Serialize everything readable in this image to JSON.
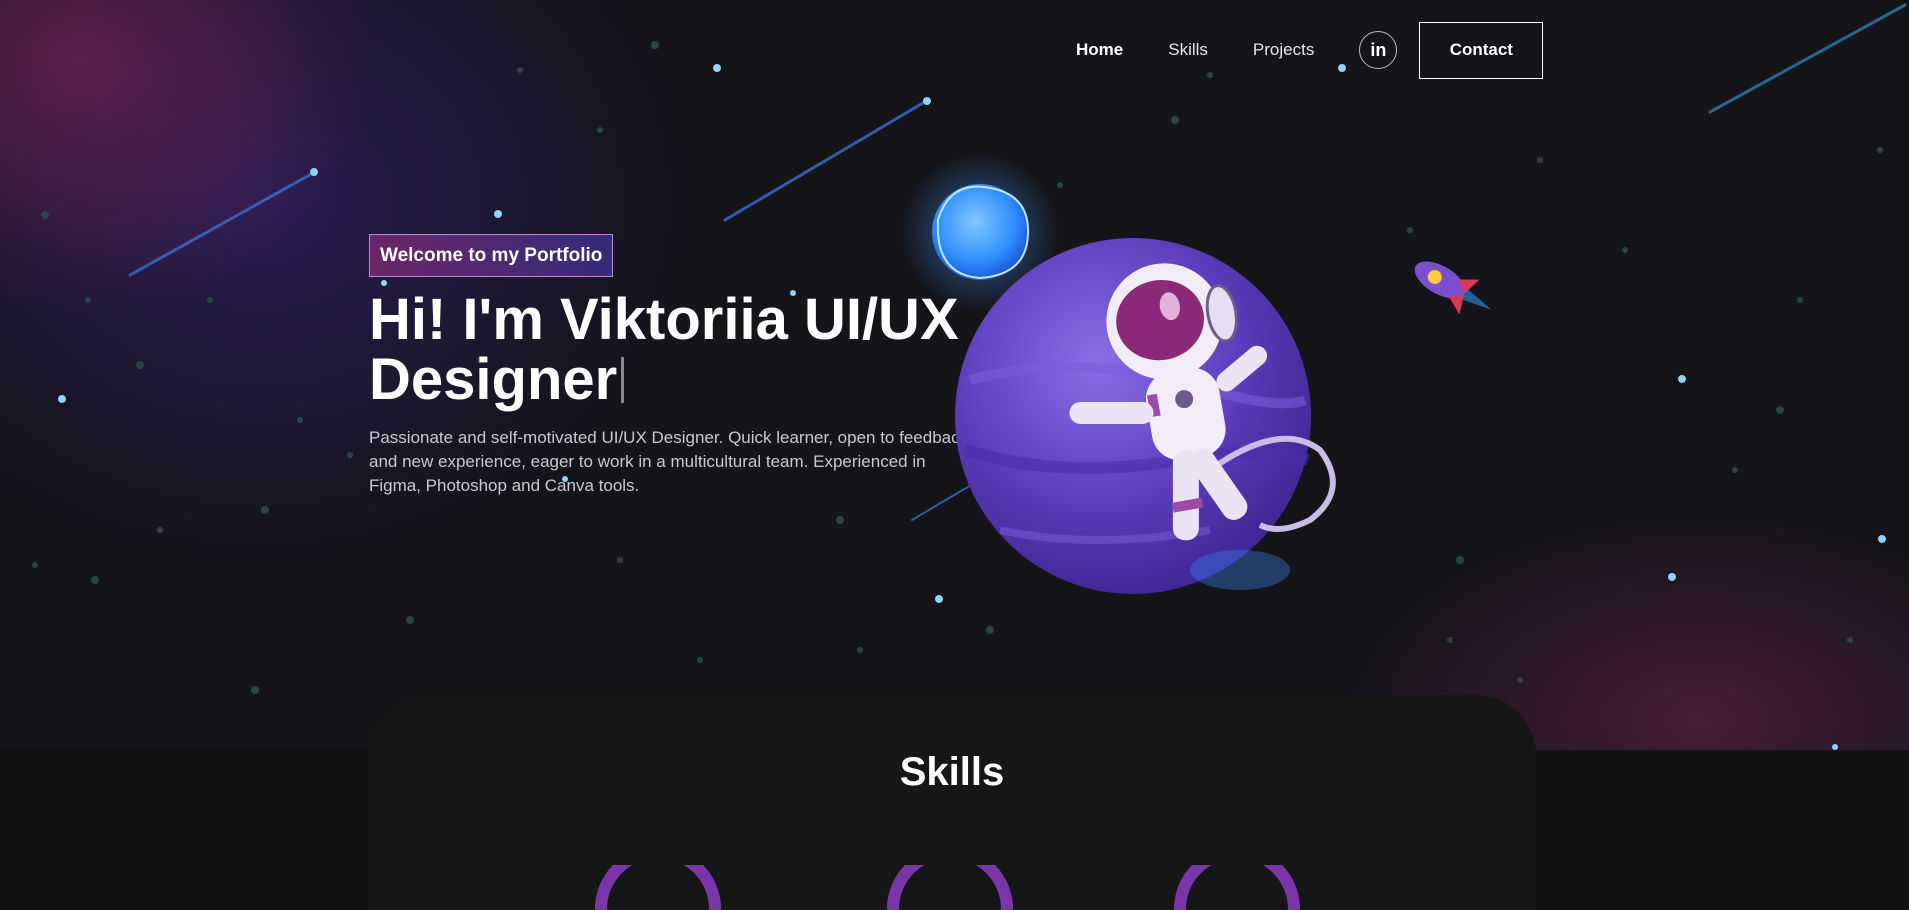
{
  "nav": {
    "items": [
      {
        "label": "Home",
        "active": true
      },
      {
        "label": "Skills",
        "active": false
      },
      {
        "label": "Projects",
        "active": false
      }
    ],
    "linkedin_label": "in",
    "contact_label": "Contact"
  },
  "hero": {
    "tag": "Welcome to my Portfolio",
    "headline_line1": "Hi! I'm Viktoriia UI/UX",
    "headline_line2": "Designer",
    "description": "Passionate and self-motivated UI/UX Designer. Quick learner, open to feedback and new experience, eager to work in a multicultural team. Experienced in Figma, Photoshop and Canva tools."
  },
  "skills": {
    "title": "Skills"
  },
  "colors": {
    "background": "#121212",
    "accent_purple": "#6a3fc8",
    "accent_magenta": "#9a2f86",
    "star_blue": "#8fd3ff"
  }
}
